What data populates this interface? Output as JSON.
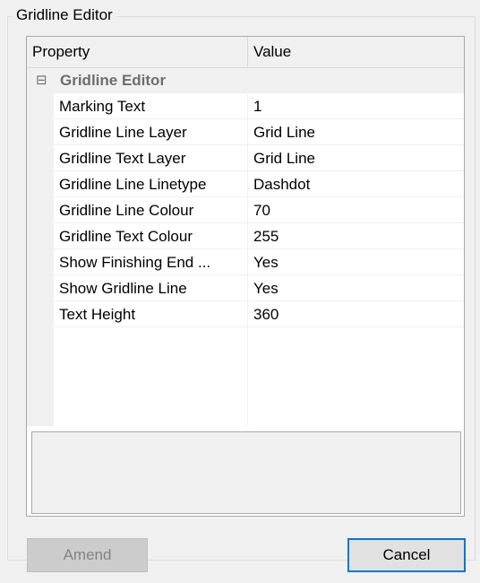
{
  "groupbox": {
    "title": "Gridline Editor"
  },
  "grid": {
    "headers": {
      "property": "Property",
      "value": "Value"
    },
    "category": {
      "toggle": "⊟",
      "label": "Gridline Editor"
    },
    "rows": [
      {
        "name": "Marking Text",
        "value": "1"
      },
      {
        "name": "Gridline Line Layer",
        "value": "Grid Line"
      },
      {
        "name": "Gridline Text Layer",
        "value": "Grid Line"
      },
      {
        "name": "Gridline Line Linetype",
        "value": "Dashdot"
      },
      {
        "name": "Gridline Line Colour",
        "value": "70"
      },
      {
        "name": "Gridline Text Colour",
        "value": "255"
      },
      {
        "name": "Show Finishing End ...",
        "value": "Yes"
      },
      {
        "name": "Show Gridline Line",
        "value": "Yes"
      },
      {
        "name": "Text Height",
        "value": "360"
      }
    ]
  },
  "buttons": {
    "amend": "Amend",
    "cancel": "Cancel"
  },
  "colors": {
    "accent": "#0078d7",
    "category_text": "#6d6d6d",
    "background": "#f0f0f0"
  }
}
